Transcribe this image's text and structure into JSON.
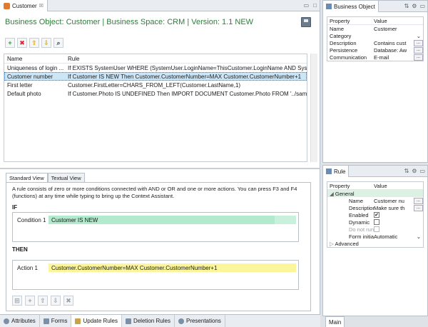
{
  "editor": {
    "tab_label": "Customer",
    "tab_close": "☒",
    "header_title": "Business Object: Customer   |   Business Space: CRM   |   Version: 1.1 NEW"
  },
  "toolbar": {
    "add": "+",
    "delete": "✖",
    "up": "⇧",
    "down": "⇩",
    "binoculars": "⌕"
  },
  "rules_table": {
    "columns": [
      "Name",
      "Rule"
    ],
    "rows": [
      {
        "name": "Uniqueness of login ...",
        "rule": "If EXISTS SystemUser WHERE (SystemUser.LoginName=ThisCustomer.LoginName AND SystemU..."
      },
      {
        "name": "Customer number",
        "rule": "If Customer IS NEW  Then Customer.CustomerNumber=MAX Customer.CustomerNumber+1"
      },
      {
        "name": "First letter",
        "rule": "Customer.FirstLetter=CHARS_FROM_LEFT(Customer.LastName,1)"
      },
      {
        "name": "Default photo",
        "rule": "If Customer.Photo IS UNDEFINED Then IMPORT DOCUMENT Customer.Photo FROM '../samples..."
      }
    ]
  },
  "rule_editor": {
    "tabs": [
      "Standard View",
      "Textual View"
    ],
    "description": "A rule consists of zero or more conditions connected with AND or OR  and one or more actions. You can press F3 and F4 (functions) at any time while typing to bring up the Context Assistant.",
    "if_label": "IF",
    "then_label": "THEN",
    "condition": {
      "label": "Condition 1",
      "value": "Customer IS NEW"
    },
    "action": {
      "label": "Action 1",
      "value": "Customer.CustomerNumber=MAX Customer.CustomerNumber+1"
    }
  },
  "editor_tabs": [
    "Attributes",
    "Forms",
    "Update Rules",
    "Deletion Rules",
    "Presentations"
  ],
  "bo_panel": {
    "tab_label": "Business Object",
    "columns": [
      "Property",
      "Value"
    ],
    "rows": [
      {
        "k": "Name",
        "v": "Customer"
      },
      {
        "k": "Category",
        "v": ""
      },
      {
        "k": "Description",
        "v": "Contains cust"
      },
      {
        "k": "Persistence",
        "v": "Database: Aw"
      },
      {
        "k": "Communication",
        "v": "E-mail"
      }
    ]
  },
  "rule_panel": {
    "tab_label": "Rule",
    "columns": [
      "Property",
      "Value"
    ],
    "group_general": "General",
    "rows": [
      {
        "k": "Name",
        "v": "Customer nu"
      },
      {
        "k": "Description",
        "v": "Make sure th"
      },
      {
        "k": "Enabled",
        "v": "✔"
      },
      {
        "k": "Dynamic",
        "v": ""
      },
      {
        "k": "Do not run",
        "v": ""
      },
      {
        "k": "Form initia",
        "v": "Automatic"
      }
    ],
    "group_advanced": "Advanced"
  },
  "main_tab": "Main",
  "colors": {
    "header_green": "#2f7d3a",
    "condition_bg": "#b3e9cc",
    "action_bg": "#fbf59b",
    "selection": "#cde6f7"
  }
}
